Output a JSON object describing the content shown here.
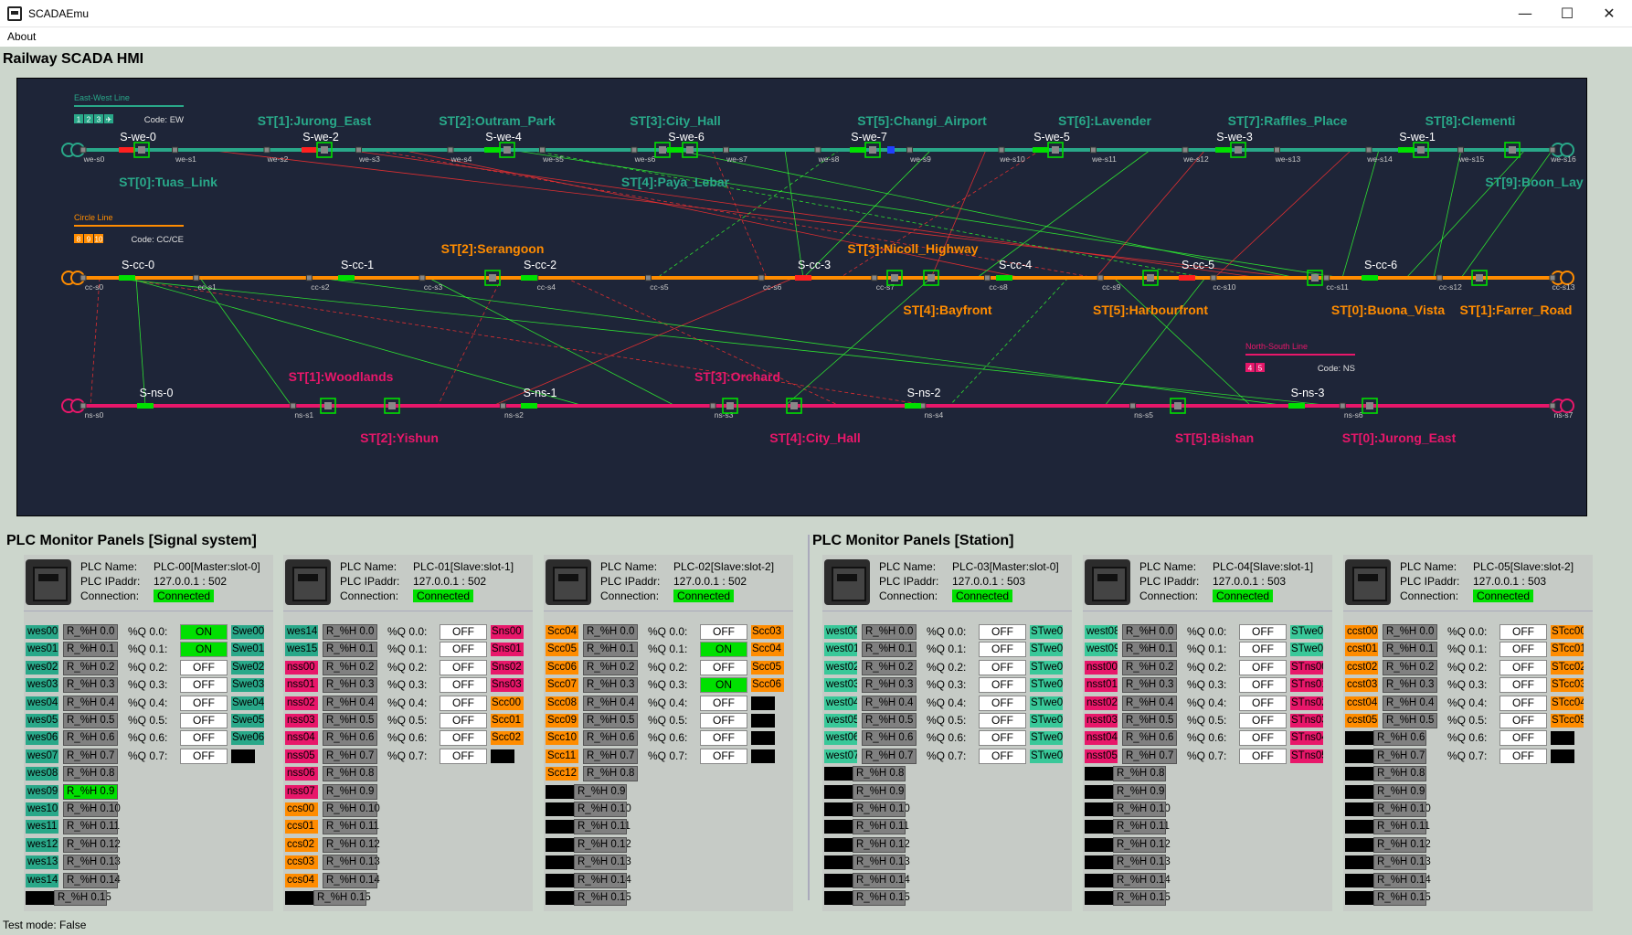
{
  "window": {
    "title": "SCADAEmu",
    "min": "—",
    "max": "☐",
    "close": "✕"
  },
  "menu": {
    "about": "About"
  },
  "hmi_title": "Railway SCADA HMI",
  "colors": {
    "ew": "#29a889",
    "cc": "#ff8c00",
    "ns": "#e8176a",
    "tag_ew": "#29a889",
    "tag_cc": "#ff8c00",
    "tag_ns": "#e8176a",
    "tag_st": "#39c899"
  },
  "legends": {
    "ew": {
      "title": "East-West Line",
      "chips": [
        "1",
        "2",
        "3",
        "✈"
      ],
      "code": "Code: EW"
    },
    "cc": {
      "title": "Circle Line",
      "chips": [
        "8",
        "9",
        "10"
      ],
      "code": "Code: CC/CE"
    },
    "ns": {
      "title": "North-South Line",
      "chips": [
        "4",
        "5"
      ],
      "code": "Code: NS"
    }
  },
  "lines": [
    {
      "id": "ew",
      "color": "#29a889",
      "sensors": [
        "we-s0",
        "we-s1",
        "we-s2",
        "we-s3",
        "we-s4",
        "we-s5",
        "we-s6",
        "we-s7",
        "we-s8",
        "we-s9",
        "we-s10",
        "we-s11",
        "we-s12",
        "we-s13",
        "we-s14",
        "we-s15",
        "we-s16"
      ],
      "signals": [
        "S-we-0",
        "S-we-2",
        "S-we-4",
        "S-we-6",
        "S-we-7",
        "S-we-5",
        "S-we-3",
        "S-we-1"
      ],
      "stations_top": [
        "ST[1]:Jurong_East",
        "ST[2]:Outram_Park",
        "ST[3]:City_Hall",
        "ST[5]:Changi_Airport",
        "ST[6]:Lavender",
        "ST[7]:Raffles_Place",
        "ST[8]:Clementi"
      ],
      "stations_bottom": [
        "ST[0]:Tuas_Link",
        "ST[4]:Paya_Lebar",
        "ST[9]:Boon_Lay"
      ]
    },
    {
      "id": "cc",
      "color": "#ff8c00",
      "sensors": [
        "cc-s0",
        "cc-s1",
        "cc-s2",
        "cc-s3",
        "cc-s4",
        "cc-s5",
        "cc-s6",
        "cc-s7",
        "cc-s8",
        "cc-s9",
        "cc-s10",
        "cc-s11",
        "cc-s12",
        "cc-s13"
      ],
      "signals": [
        "S-cc-0",
        "S-cc-1",
        "S-cc-2",
        "S-cc-3",
        "S-cc-4",
        "S-cc-5",
        "S-cc-6"
      ],
      "stations_top": [
        "ST[2]:Serangoon",
        "ST[3]:Nicoll_Highway"
      ],
      "stations_bottom": [
        "ST[4]:Bayfront",
        "ST[5]:Harbourfront",
        "ST[0]:Buona_Vista",
        "ST[1]:Farrer_Road"
      ]
    },
    {
      "id": "ns",
      "color": "#e8176a",
      "sensors": [
        "ns-s0",
        "ns-s1",
        "ns-s2",
        "ns-s3",
        "ns-s4",
        "ns-s5",
        "ns-s6",
        "ns-s7"
      ],
      "signals": [
        "S-ns-0",
        "S-ns-1",
        "S-ns-2",
        "S-ns-3"
      ],
      "stations_top": [
        "ST[1]:Woodlands",
        "ST[3]:Orchard"
      ],
      "stations_bottom": [
        "ST[2]:Yishun",
        "ST[4]:City_Hall",
        "ST[5]:Bishan",
        "ST[0]:Jurong_East"
      ]
    }
  ],
  "sections": {
    "signal": "PLC Monitor Panels [Signal system]",
    "station": "PLC Monitor Panels [Station]"
  },
  "plc_keys": {
    "name": "PLC Name:",
    "ip": "PLC IPaddr:",
    "conn": "Connection:"
  },
  "plcs": [
    {
      "name": "PLC-00[Master:slot-0]",
      "ip": "127.0.0.1 : 502",
      "conn": "Connected",
      "inputs": [
        [
          "wes00",
          "ew"
        ],
        [
          "wes01",
          "ew"
        ],
        [
          "wes02",
          "ew"
        ],
        [
          "wes03",
          "ew"
        ],
        [
          "wes04",
          "ew"
        ],
        [
          "wes05",
          "ew"
        ],
        [
          "wes06",
          "ew"
        ],
        [
          "wes07",
          "ew"
        ],
        [
          "wes08",
          "ew"
        ],
        [
          "wes09",
          "ew"
        ],
        [
          "wes10",
          "ew"
        ],
        [
          "wes11",
          "ew"
        ],
        [
          "wes12",
          "ew"
        ],
        [
          "wes13",
          "ew"
        ],
        [
          "wes14",
          "ew"
        ],
        [
          "",
          ""
        ]
      ],
      "holding_on": [
        9
      ],
      "coils": [
        "ON",
        "ON",
        "OFF",
        "OFF",
        "OFF",
        "OFF",
        "OFF",
        "OFF"
      ],
      "outputs": [
        [
          "Swe00",
          "ew"
        ],
        [
          "Swe01",
          "ew"
        ],
        [
          "Swe02",
          "ew"
        ],
        [
          "Swe03",
          "ew"
        ],
        [
          "Swe04",
          "ew"
        ],
        [
          "Swe05",
          "ew"
        ],
        [
          "Swe06",
          "ew"
        ],
        [
          "",
          ""
        ]
      ]
    },
    {
      "name": "PLC-01[Slave:slot-1]",
      "ip": "127.0.0.1 : 502",
      "conn": "Connected",
      "inputs": [
        [
          "wes14",
          "ew"
        ],
        [
          "wes15",
          "ew"
        ],
        [
          "nss00",
          "ns"
        ],
        [
          "nss01",
          "ns"
        ],
        [
          "nss02",
          "ns"
        ],
        [
          "nss03",
          "ns"
        ],
        [
          "nss04",
          "ns"
        ],
        [
          "nss05",
          "ns"
        ],
        [
          "nss06",
          "ns"
        ],
        [
          "nss07",
          "ns"
        ],
        [
          "ccs00",
          "cc"
        ],
        [
          "ccs01",
          "cc"
        ],
        [
          "ccs02",
          "cc"
        ],
        [
          "ccs03",
          "cc"
        ],
        [
          "ccs04",
          "cc"
        ],
        [
          "",
          ""
        ]
      ],
      "holding_on": [],
      "coils": [
        "OFF",
        "OFF",
        "OFF",
        "OFF",
        "OFF",
        "OFF",
        "OFF",
        "OFF"
      ],
      "outputs": [
        [
          "Sns00",
          "ns"
        ],
        [
          "Sns01",
          "ns"
        ],
        [
          "Sns02",
          "ns"
        ],
        [
          "Sns03",
          "ns"
        ],
        [
          "Scc00",
          "cc"
        ],
        [
          "Scc01",
          "cc"
        ],
        [
          "Scc02",
          "cc"
        ],
        [
          "",
          ""
        ]
      ]
    },
    {
      "name": "PLC-02[Slave:slot-2]",
      "ip": "127.0.0.1 : 502",
      "conn": "Connected",
      "inputs": [
        [
          "Scc04",
          "cc"
        ],
        [
          "Scc05",
          "cc"
        ],
        [
          "Scc06",
          "cc"
        ],
        [
          "Scc07",
          "cc"
        ],
        [
          "Scc08",
          "cc"
        ],
        [
          "Scc09",
          "cc"
        ],
        [
          "Scc10",
          "cc"
        ],
        [
          "Scc11",
          "cc"
        ],
        [
          "Scc12",
          "cc"
        ],
        [
          "",
          ""
        ],
        [
          "",
          ""
        ],
        [
          "",
          ""
        ],
        [
          "",
          ""
        ],
        [
          "",
          ""
        ],
        [
          "",
          ""
        ],
        [
          "",
          ""
        ]
      ],
      "holding_on": [],
      "coils": [
        "OFF",
        "ON",
        "OFF",
        "ON",
        "OFF",
        "OFF",
        "OFF",
        "OFF"
      ],
      "outputs": [
        [
          "Scc03",
          "cc"
        ],
        [
          "Scc04",
          "cc"
        ],
        [
          "Scc05",
          "cc"
        ],
        [
          "Scc06",
          "cc"
        ],
        [
          "",
          ""
        ],
        [
          "",
          ""
        ],
        [
          "",
          ""
        ],
        [
          "",
          ""
        ]
      ]
    },
    {
      "name": "PLC-03[Master:slot-0]",
      "ip": "127.0.0.1 : 503",
      "conn": "Connected",
      "inputs": [
        [
          "west00",
          "st"
        ],
        [
          "west01",
          "st"
        ],
        [
          "west02",
          "st"
        ],
        [
          "west03",
          "st"
        ],
        [
          "west04",
          "st"
        ],
        [
          "west05",
          "st"
        ],
        [
          "west06",
          "st"
        ],
        [
          "west07",
          "st"
        ],
        [
          "",
          ""
        ],
        [
          "",
          ""
        ],
        [
          "",
          ""
        ],
        [
          "",
          ""
        ],
        [
          "",
          ""
        ],
        [
          "",
          ""
        ],
        [
          "",
          ""
        ],
        [
          "",
          ""
        ]
      ],
      "holding_on": [],
      "coils": [
        "OFF",
        "OFF",
        "OFF",
        "OFF",
        "OFF",
        "OFF",
        "OFF",
        "OFF"
      ],
      "outputs": [
        [
          "STwe00",
          "st"
        ],
        [
          "STwe01",
          "st"
        ],
        [
          "STwe02",
          "st"
        ],
        [
          "STwe03",
          "st"
        ],
        [
          "STwe04",
          "st"
        ],
        [
          "STwe05",
          "st"
        ],
        [
          "STwe06",
          "st"
        ],
        [
          "STwe07",
          "st"
        ]
      ]
    },
    {
      "name": "PLC-04[Slave:slot-1]",
      "ip": "127.0.0.1 : 503",
      "conn": "Connected",
      "inputs": [
        [
          "west08",
          "st"
        ],
        [
          "west09",
          "st"
        ],
        [
          "nsst00",
          "ns"
        ],
        [
          "nsst01",
          "ns"
        ],
        [
          "nsst02",
          "ns"
        ],
        [
          "nsst03",
          "ns"
        ],
        [
          "nsst04",
          "ns"
        ],
        [
          "nsst05",
          "ns"
        ],
        [
          "",
          ""
        ],
        [
          "",
          ""
        ],
        [
          "",
          ""
        ],
        [
          "",
          ""
        ],
        [
          "",
          ""
        ],
        [
          "",
          ""
        ],
        [
          "",
          ""
        ],
        [
          "",
          ""
        ]
      ],
      "holding_on": [],
      "coils": [
        "OFF",
        "OFF",
        "OFF",
        "OFF",
        "OFF",
        "OFF",
        "OFF",
        "OFF"
      ],
      "outputs": [
        [
          "STwe08",
          "st"
        ],
        [
          "STwe09",
          "st"
        ],
        [
          "STns00",
          "ns"
        ],
        [
          "STns01",
          "ns"
        ],
        [
          "STns02",
          "ns"
        ],
        [
          "STns03",
          "ns"
        ],
        [
          "STns04",
          "ns"
        ],
        [
          "STns05",
          "ns"
        ]
      ]
    },
    {
      "name": "PLC-05[Slave:slot-2]",
      "ip": "127.0.0.1 : 503",
      "conn": "Connected",
      "inputs": [
        [
          "ccst00",
          "cc"
        ],
        [
          "ccst01",
          "cc"
        ],
        [
          "ccst02",
          "cc"
        ],
        [
          "ccst03",
          "cc"
        ],
        [
          "ccst04",
          "cc"
        ],
        [
          "ccst05",
          "cc"
        ],
        [
          "",
          ""
        ],
        [
          "",
          ""
        ],
        [
          "",
          ""
        ],
        [
          "",
          ""
        ],
        [
          "",
          ""
        ],
        [
          "",
          ""
        ],
        [
          "",
          ""
        ],
        [
          "",
          ""
        ],
        [
          "",
          ""
        ],
        [
          "",
          ""
        ]
      ],
      "holding_on": [],
      "coils": [
        "OFF",
        "OFF",
        "OFF",
        "OFF",
        "OFF",
        "OFF",
        "OFF",
        "OFF"
      ],
      "outputs": [
        [
          "STcc00",
          "cc"
        ],
        [
          "STcc01",
          "cc"
        ],
        [
          "STcc02",
          "cc"
        ],
        [
          "STcc03",
          "cc"
        ],
        [
          "STcc04",
          "cc"
        ],
        [
          "STcc05",
          "cc"
        ],
        [
          "",
          ""
        ],
        [
          "",
          ""
        ]
      ]
    }
  ],
  "holding_labels": [
    "R_%H 0.0",
    "R_%H 0.1",
    "R_%H 0.2",
    "R_%H 0.3",
    "R_%H 0.4",
    "R_%H 0.5",
    "R_%H 0.6",
    "R_%H 0.7",
    "R_%H 0.8",
    "R_%H 0.9",
    "R_%H 0.10",
    "R_%H 0.11",
    "R_%H 0.12",
    "R_%H 0.13",
    "R_%H 0.14",
    "R_%H 0.15"
  ],
  "coil_labels": [
    "%Q 0.0:",
    "%Q 0.1:",
    "%Q 0.2:",
    "%Q 0.3:",
    "%Q 0.4:",
    "%Q 0.5:",
    "%Q 0.6:",
    "%Q 0.7:"
  ],
  "status": "Test mode: False"
}
